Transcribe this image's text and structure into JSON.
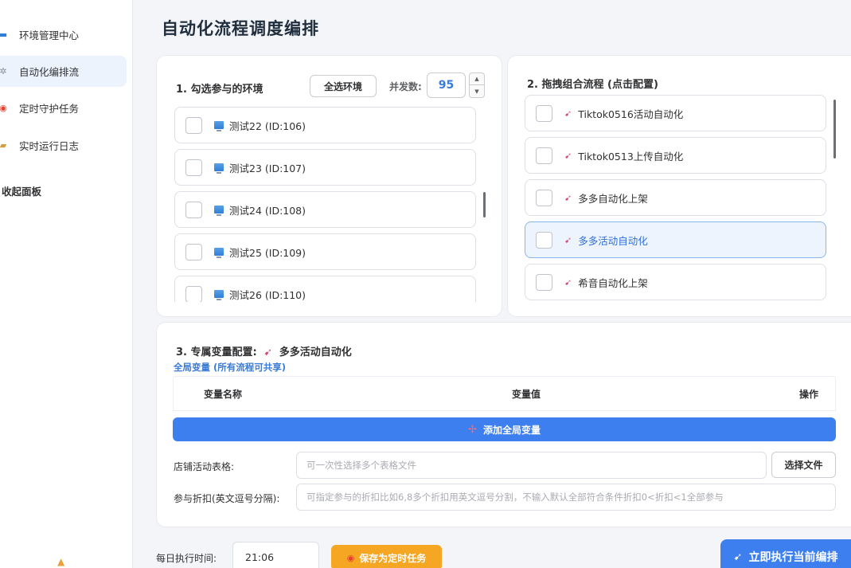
{
  "sidebar": {
    "items": [
      {
        "label": "环境管理中心",
        "icon": "monitor-icon"
      },
      {
        "label": "自动化编排流",
        "icon": "gear-icon"
      },
      {
        "label": "定时守护任务",
        "icon": "alarm-clock-icon"
      },
      {
        "label": "实时运行日志",
        "icon": "notepad-icon"
      }
    ],
    "collapse_label": "收起面板",
    "active_index": 1
  },
  "page": {
    "title": "自动化流程调度编排"
  },
  "env_panel": {
    "title": "1. 勾选参与的环境",
    "select_all_label": "全选环境",
    "concurrency_label": "并发数:",
    "concurrency_value": "95",
    "stepper_up": "▲",
    "stepper_down": "▼",
    "items": [
      {
        "label": "测试22 (ID:106)"
      },
      {
        "label": "测试23 (ID:107)"
      },
      {
        "label": "测试24 (ID:108)"
      },
      {
        "label": "测试25 (ID:109)"
      },
      {
        "label": "测试26 (ID:110)"
      }
    ]
  },
  "flow_panel": {
    "title": "2. 拖拽组合流程 (点击配置)",
    "items": [
      {
        "label": "Tiktok0516活动自动化"
      },
      {
        "label": "Tiktok0513上传自动化"
      },
      {
        "label": "多多自动化上架"
      },
      {
        "label": "多多活动自动化"
      },
      {
        "label": "希音自动化上架"
      }
    ],
    "selected_index": 3
  },
  "var_panel": {
    "title_prefix": "3. 专属变量配置:",
    "title_flow": "多多活动自动化",
    "global_link": "全局变量 (所有流程可共享)",
    "table_headers": {
      "name": "变量名称",
      "value": "变量值",
      "ops": "操作"
    },
    "add_global_var_label": "添加全局变量",
    "add_icon": "✢",
    "store_table_label": "店铺活动表格:",
    "store_table_placeholder": "可一次性选择多个表格文件",
    "choose_file_label": "选择文件",
    "discount_label": "参与折扣(英文逗号分隔):",
    "discount_placeholder": "可指定参与的折扣比如6,8多个折扣用英文逗号分割，不输入默认全部符合条件折扣0<折扣<1全部参与"
  },
  "bottom_bar": {
    "daily_time_label": "每日执行时间:",
    "daily_time_value": "21:06",
    "save_schedule_label": "保存为定时任务",
    "run_now_label": "立即执行当前编排"
  },
  "colors": {
    "primary": "#3d7fee",
    "warning": "#f5a623",
    "selected_bg": "#eef4fd"
  }
}
